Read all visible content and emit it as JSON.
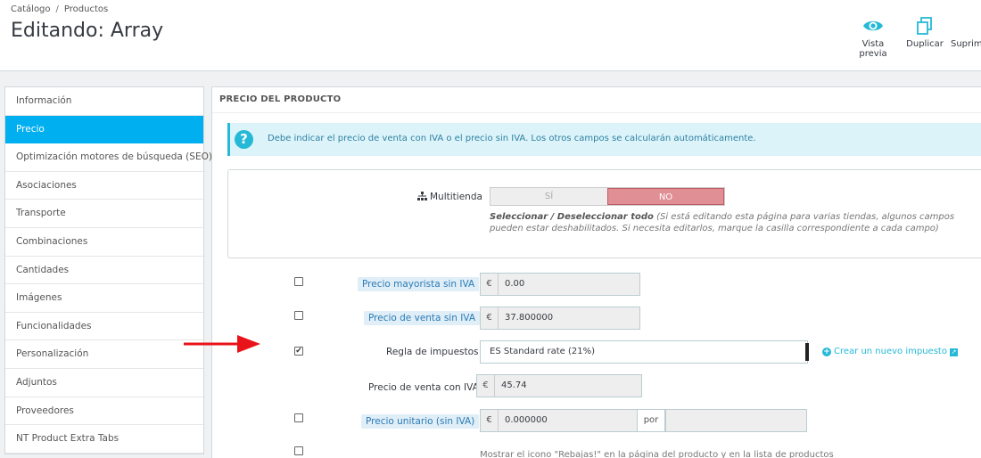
{
  "breadcrumb": {
    "parent": "Catálogo",
    "separator": "/",
    "current": "Productos"
  },
  "page_title": "Editando: Array",
  "toolbar": {
    "preview_label": "Vista previa",
    "duplicate_label": "Duplicar",
    "delete_label": "Suprimir"
  },
  "sidebar": {
    "items": [
      {
        "label": "Información",
        "active": false
      },
      {
        "label": "Precio",
        "active": true
      },
      {
        "label": "Optimización motores de búsqueda (SEO)",
        "active": false
      },
      {
        "label": "Asociaciones",
        "active": false
      },
      {
        "label": "Transporte",
        "active": false
      },
      {
        "label": "Combinaciones",
        "active": false
      },
      {
        "label": "Cantidades",
        "active": false
      },
      {
        "label": "Imágenes",
        "active": false
      },
      {
        "label": "Funcionalidades",
        "active": false
      },
      {
        "label": "Personalización",
        "active": false
      },
      {
        "label": "Adjuntos",
        "active": false
      },
      {
        "label": "Proveedores",
        "active": false
      },
      {
        "label": "NT Product Extra Tabs",
        "active": false
      }
    ]
  },
  "panel": {
    "heading": "PRECIO DEL PRODUCTO",
    "alert": "Debe indicar el precio de venta con IVA o el precio sin IVA. Los otros campos se calcularán automáticamente.",
    "multistore": {
      "label": "Multitienda",
      "yes": "SÍ",
      "no": "NO",
      "help_bold": "Seleccionar / Deseleccionar todo",
      "help_text": " (Si está editando esta página para varias tiendas, algunos campos pueden estar deshabilitados. Si necesita editarlos, marque la casilla correspondiente a cada campo)"
    },
    "fields": {
      "wholesale": {
        "label": "Precio mayorista sin IVA",
        "currency": "€",
        "value": "0.00",
        "checked": false
      },
      "price_excl": {
        "label": "Precio de venta sin IVA",
        "currency": "€",
        "value": "37.800000",
        "checked": false
      },
      "tax_rule": {
        "label": "Regla de impuestos",
        "value": "ES Standard rate (21%)",
        "checked": true,
        "create_link": "Crear un nuevo impuesto"
      },
      "price_incl": {
        "label": "Precio de venta con IVA",
        "currency": "€",
        "value": "45.74"
      },
      "unit_price": {
        "label": "Precio unitario (sin IVA)",
        "currency": "€",
        "value": "0.000000",
        "per": "por",
        "checked": false
      },
      "on_sale": {
        "checked": false,
        "text": "Mostrar el icono \"Rebajas!\" en la página del producto y en la lista de productos"
      }
    }
  },
  "colors": {
    "accent": "#25b9d7",
    "sidebar_active": "#00aff0",
    "switch_no": "#e08f95",
    "annotation_arrow": "#e8141a"
  },
  "icons": {
    "preview": "eye-icon",
    "duplicate": "copy-icon",
    "alert": "question-icon",
    "multistore": "sitemap-icon",
    "create": "plus-circle-icon",
    "external": "external-link-icon"
  }
}
